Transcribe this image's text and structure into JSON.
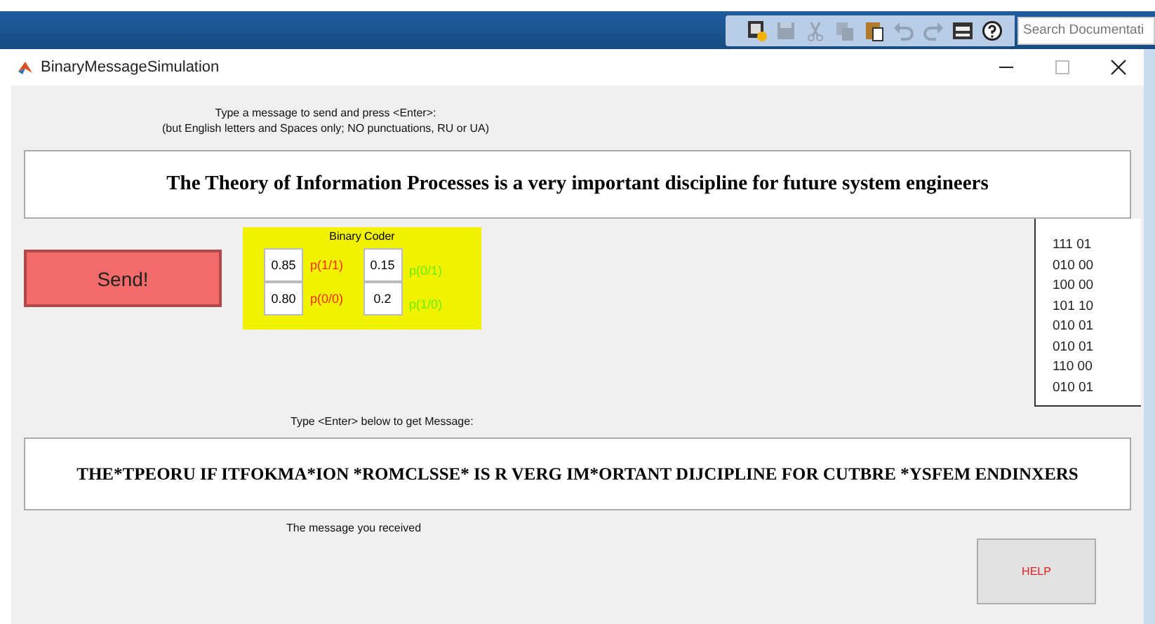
{
  "toolbar": {
    "buttons": [
      {
        "kind": "new",
        "disabled": false
      },
      {
        "kind": "save",
        "disabled": true
      },
      {
        "kind": "cut",
        "disabled": true
      },
      {
        "kind": "copy",
        "disabled": true
      },
      {
        "kind": "paste",
        "disabled": false
      },
      {
        "kind": "undo",
        "disabled": true
      },
      {
        "kind": "redo",
        "disabled": true
      },
      {
        "kind": "window",
        "disabled": false
      },
      {
        "kind": "help",
        "disabled": false
      }
    ],
    "search": {
      "placeholder": "Search Documentati"
    }
  },
  "window": {
    "title": "BinaryMessageSimulation"
  },
  "prompt": [
    "Type a message to send and press <Enter>:",
    "(but English letters and Spaces only; NO punctuations, RU or UA)"
  ],
  "message_input": {
    "value": "The Theory of Information Processes is a very important discipline for future system engineers"
  },
  "send_button": {
    "label": "Send!"
  },
  "binary_coder": {
    "title": "Binary Coder",
    "rows": [
      {
        "cells": [
          {
            "value": "0.85",
            "label": "p(1/1)",
            "color": "#ff2a00"
          },
          {
            "value": "0.15",
            "label": "p(0/1)",
            "color": "#66ee00"
          }
        ]
      },
      {
        "cells": [
          {
            "value": "0.80",
            "label": "p(0/0)",
            "color": "#ff2a00"
          },
          {
            "value": "0.2",
            "label": "p(1/0)",
            "color": "#66ee00"
          }
        ]
      }
    ]
  },
  "code_list": [
    "111 01",
    "010 00",
    "100 00",
    "101 10",
    "010 01",
    "010 01",
    "110 00",
    "010 01"
  ],
  "output_prompt": "Type <Enter> below to get Message:",
  "output": {
    "value": "THE*TPEORU IF ITFOKMA*ION *ROMCLSSE* IS R VERG IM*ORTANT DIJCIPLINE FOR CUTBRE *YSFEM ENDINXERS"
  },
  "output_caption": "The message you received",
  "help_button": {
    "label": "HELP"
  }
}
